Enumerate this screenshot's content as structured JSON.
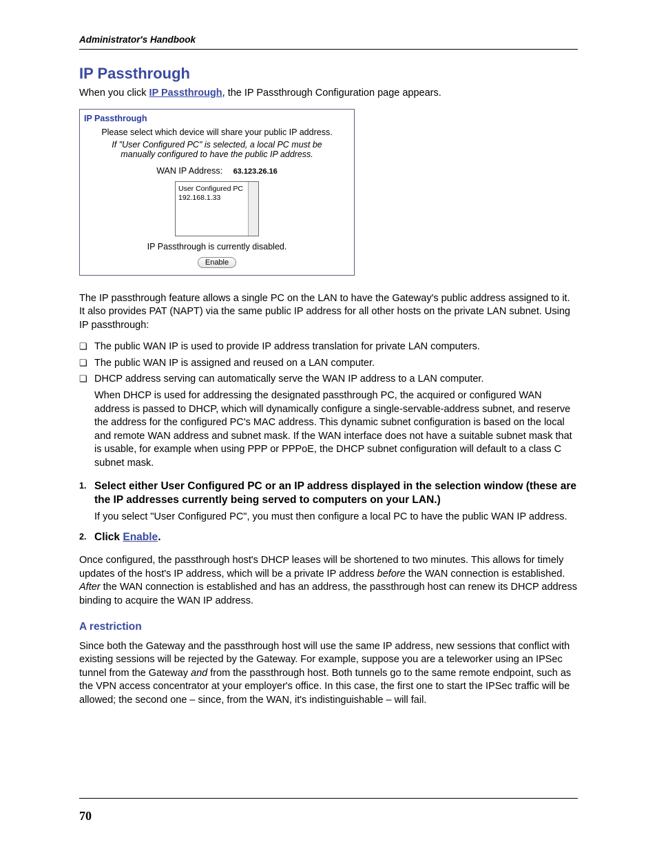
{
  "header": {
    "running_title": "Administrator's Handbook"
  },
  "section": {
    "title": "IP Passthrough",
    "intro_pre": "When you click ",
    "intro_link": "IP Passthrough",
    "intro_post": ", the IP Passthrough Configuration page appears."
  },
  "panel": {
    "title": "IP Passthrough",
    "instruction": "Please select which device will share your public IP address.",
    "note": "If \"User Configured PC\" is selected, a local PC must be manually configured to have the public IP address.",
    "wan_label": "WAN IP Address:",
    "wan_ip": "63.123.26.16",
    "listbox_line1": "User Configured PC",
    "listbox_line2": "192.168.1.33",
    "status": "IP Passthrough is currently disabled.",
    "enable_button": "Enable"
  },
  "paragraphs": {
    "feature": "The IP passthrough feature allows a single PC on the LAN to have the Gateway's public address assigned to it. It also provides PAT (NAPT) via the same public IP address for all other hosts on the private LAN subnet. Using IP passthrough:"
  },
  "bullets": {
    "b1": "The public WAN IP is used to provide IP address translation for private LAN computers.",
    "b2": "The public WAN IP is assigned and reused on a LAN computer.",
    "b3": "DHCP address serving can automatically serve the WAN IP address to a LAN computer.",
    "b3_detail": "When DHCP is used for addressing the designated passthrough PC, the acquired or configured WAN address is passed to DHCP, which will dynamically configure a single-servable-address subnet, and reserve the address for the configured PC's MAC address. This dynamic subnet configuration is based on the local and remote WAN address and subnet mask. If the WAN interface does not have a suitable subnet mask that is usable, for example when using PPP or PPPoE, the DHCP subnet configuration will default to a class C subnet mask."
  },
  "steps": {
    "s1": "Select either User Configured PC or an IP address displayed in the selection window (these are the IP addresses currently being served to computers on your LAN.)",
    "s1_detail": "If you select \"User Configured PC\", you must then configure a local PC to have the public WAN IP address.",
    "s2_pre": "Click ",
    "s2_link": "Enable",
    "s2_post": "."
  },
  "after_steps": {
    "p1_a": "Once configured, the passthrough host's DHCP leases will be shortened to two minutes. This allows for timely updates of the host's IP address, which will be a private IP address ",
    "p1_b": "before",
    "p1_c": " the WAN connection is established. ",
    "p1_d": "After",
    "p1_e": " the WAN connection is established and has an address, the passthrough host can renew its DHCP address binding to acquire the WAN IP address."
  },
  "restriction": {
    "heading": "A restriction",
    "p_a": "Since both the Gateway and the passthrough host will use the same IP address, new sessions that conflict with existing sessions will be rejected by the Gateway. For example, suppose you are a teleworker using an IPSec tunnel from the Gateway ",
    "p_b": "and",
    "p_c": " from the passthrough host. Both tunnels go to the same remote endpoint, such as the VPN access concentrator at your employer's office. In this case, the first one to start the IPSec traffic will be allowed; the second one – since, from the WAN, it's indistinguishable – will fail."
  },
  "page_number": "70"
}
